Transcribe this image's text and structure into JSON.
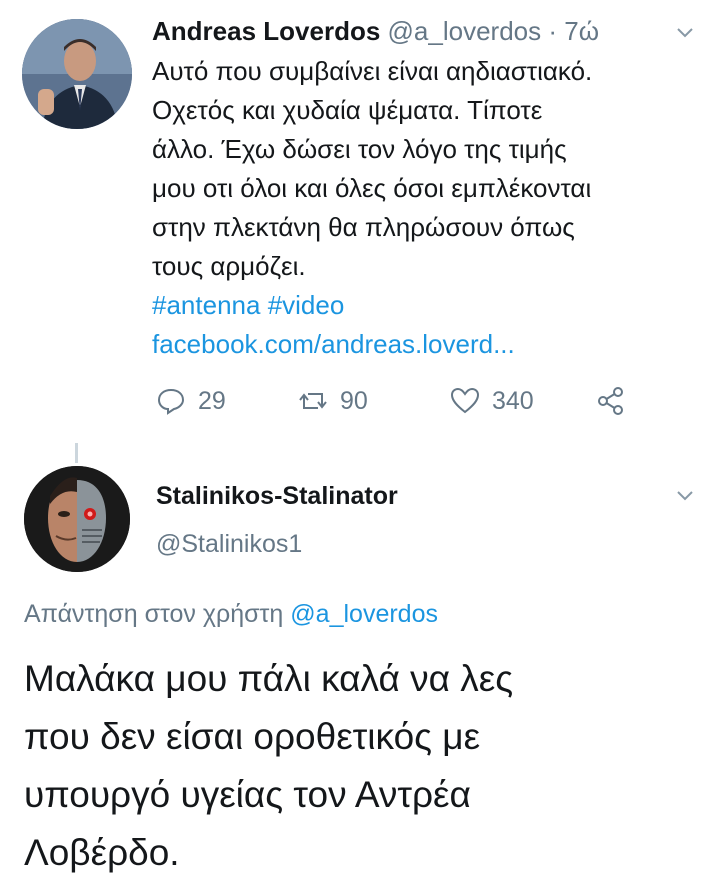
{
  "tweet1": {
    "display_name": "Andreas Loverdos",
    "handle": "@a_loverdos",
    "separator": "·",
    "time": "7ώ",
    "text_lines": [
      "Αυτό που συμβαίνει είναι αηδιαστιακό.",
      "Οχετός και χυδαία ψέματα. Τίποτε",
      "άλλο. Έχω δώσει τον λόγο της τιμής",
      "μου οτι όλοι και όλες όσοι εμπλέκονται",
      "στην πλεκτάνη θα πληρώσουν όπως",
      "τους αρμόζει."
    ],
    "hashtags": [
      "#antenna",
      "#video"
    ],
    "link": "facebook.com/andreas.loverd...",
    "replies": "29",
    "retweets": "90",
    "likes": "340"
  },
  "tweet2": {
    "display_name": "Stalinikos-Stalinator",
    "handle": "@Stalinikos1",
    "reply_prefix": "Απάντηση στον χρήστη",
    "reply_to": "@a_loverdos",
    "text_lines": [
      "Μαλάκα μου πάλι καλά να λες",
      "που δεν είσαι οροθετικός με",
      "υπουργό υγείας τον Αντρέα",
      "Λοβέρδο."
    ]
  },
  "icons": [
    "chevron-down-icon",
    "reply-icon",
    "retweet-icon",
    "like-icon",
    "share-icon"
  ],
  "colors": {
    "link": "#1b95e0",
    "muted": "#657786",
    "text": "#14171a"
  }
}
